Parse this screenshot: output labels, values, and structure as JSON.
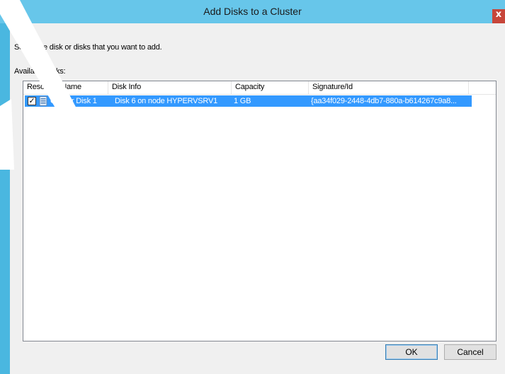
{
  "dialog": {
    "title": "Add Disks to a Cluster",
    "close_glyph": "x",
    "prompt": "Select the disk or disks that you want to add.",
    "available_label": "Available disks:"
  },
  "table": {
    "columns": [
      "Resource Name",
      "Disk Info",
      "Capacity",
      "Signature/Id"
    ],
    "rows": [
      {
        "checked": true,
        "resource_name": "Cluster Disk 1",
        "disk_info": "Disk 6 on node HYPERVSRV1",
        "capacity": "1 GB",
        "signature": "{aa34f029-2448-4db7-880a-b614267c9a8..."
      }
    ]
  },
  "buttons": {
    "ok": "OK",
    "cancel": "Cancel"
  },
  "icons": {
    "row_icon": "disk-icon",
    "checkbox": "checkbox-checked-icon",
    "close": "close-icon"
  },
  "colors": {
    "titlebar": "#67c6ea",
    "frame": "#4ab7e0",
    "close": "#c7463a",
    "selection": "#3399ff"
  }
}
